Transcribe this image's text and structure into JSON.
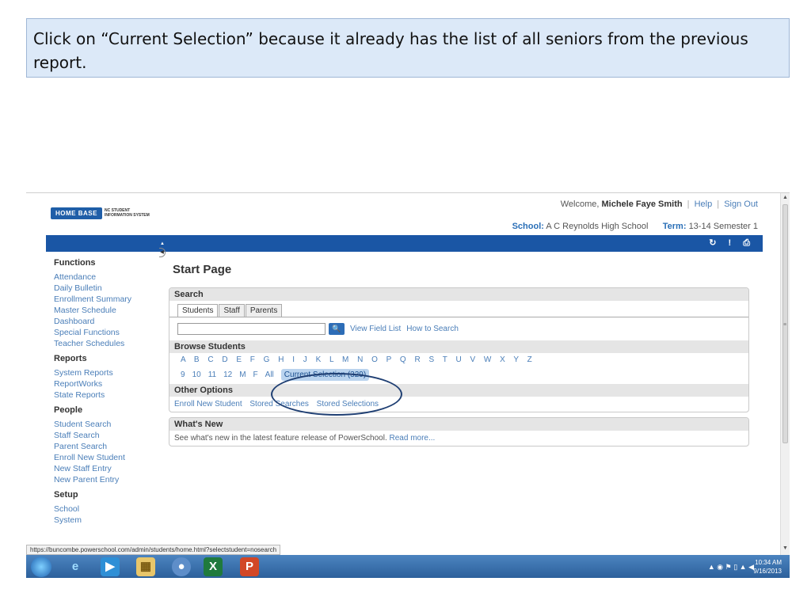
{
  "caption": "Click on “Current Selection” because it already has the  list of all seniors from the previous report.",
  "logo": {
    "brand": "HOME BASE",
    "subtitle": "NC STUDENT INFORMATION SYSTEM"
  },
  "header": {
    "welcome_prefix": "Welcome,",
    "user": "Michele Faye Smith",
    "help": "Help",
    "signout": "Sign Out",
    "school_label": "School:",
    "school": "A C Reynolds High School",
    "term_label": "Term:",
    "term": "13-14 Semester 1",
    "icons": "↻ ! ⎙"
  },
  "sidebar": {
    "functions_title": "Functions",
    "functions": [
      "Attendance",
      "Daily Bulletin",
      "Enrollment Summary",
      "Master Schedule",
      "Dashboard",
      "Special Functions",
      "Teacher Schedules"
    ],
    "reports_title": "Reports",
    "reports": [
      "System Reports",
      "ReportWorks",
      "State Reports"
    ],
    "people_title": "People",
    "people": [
      "Student Search",
      "Staff Search",
      "Parent Search",
      "Enroll New Student",
      "New Staff Entry",
      "New Parent Entry"
    ],
    "setup_title": "Setup",
    "setup": [
      "School",
      "System"
    ]
  },
  "main": {
    "title": "Start Page",
    "search_title": "Search",
    "tabs": [
      "Students",
      "Staff",
      "Parents"
    ],
    "view_field_list": "View Field List",
    "how_to_search": "How to Search",
    "browse_title": "Browse Students",
    "letters": "A B C D E F G H I J K L M N O P Q R S T U V W X Y Z",
    "grades": [
      "9",
      "10",
      "11",
      "12",
      "M",
      "F",
      "All"
    ],
    "current_selection": "Current Selection (329)",
    "other_title": "Other Options",
    "other_links": [
      "Enroll New Student",
      "Stored Searches",
      "Stored Selections"
    ],
    "whats_new_title": "What's New",
    "whats_new_text": "See what's new in the latest feature release of PowerSchool.",
    "read_more": "Read more..."
  },
  "status_url": "https://buncombe.powerschool.com/admin/students/home.html?selectstudent=nosearch",
  "taskbar": {
    "time": "10:34 AM",
    "date": "9/16/2013"
  }
}
